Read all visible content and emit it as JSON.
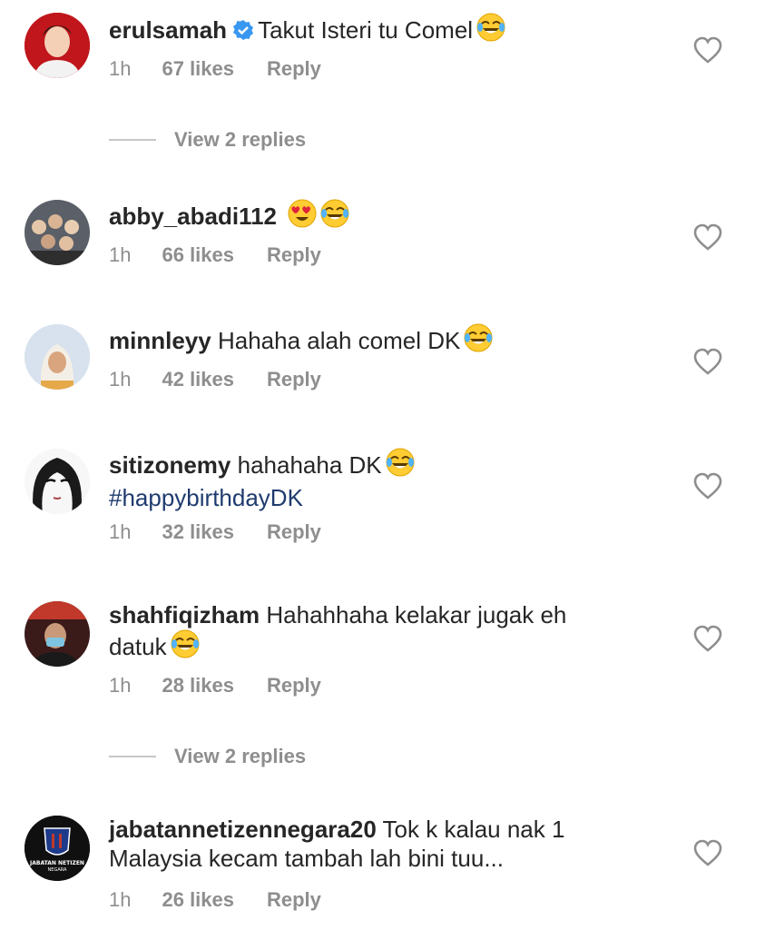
{
  "comments": [
    {
      "username": "erulsamah",
      "verified": true,
      "text": "Takut Isteri tu Comel",
      "emoji": "joy",
      "time": "1h",
      "likes": "67 likes",
      "reply": "Reply"
    },
    {
      "username": "abby_abadi112",
      "text": "",
      "emoji": "heart-eyes, joy",
      "time": "1h",
      "likes": "66 likes",
      "reply": "Reply"
    },
    {
      "username": "minnleyy",
      "text": "Hahaha alah comel DK",
      "emoji": "joy",
      "time": "1h",
      "likes": "42 likes",
      "reply": "Reply"
    },
    {
      "username": "sitizonemy",
      "text": "hahahaha DK",
      "emoji": "joy",
      "hashtag": "#happybirthdayDK",
      "time": "1h",
      "likes": "32 likes",
      "reply": "Reply"
    },
    {
      "username": "shahfiqizham",
      "text_line1": "Hahahhaha kelakar jugak eh",
      "text_line2": "datuk",
      "emoji": "joy",
      "time": "1h",
      "likes": "28 likes",
      "reply": "Reply"
    },
    {
      "username": "jabatannetizennegara20",
      "text_line1": "Tok k kalau nak 1",
      "text_line2": "Malaysia kecam tambah lah bini tuu...",
      "time": "1h",
      "likes": "26 likes",
      "reply": "Reply",
      "avatar_text": "JABATAN NETIZEN NEGARA"
    }
  ],
  "view_replies": [
    "View 2 replies",
    "View 2 replies"
  ],
  "colors": {
    "text": "#262626",
    "meta": "#8e8e8e",
    "hashtag": "#1f3b6f",
    "verified": "#3897f0"
  },
  "icons": {
    "like": "heart-outline-icon",
    "verified": "verified-badge-icon",
    "emoji_joy": "face-with-tears-of-joy-emoji",
    "emoji_heart_eyes": "smiling-face-with-heart-eyes-emoji"
  }
}
